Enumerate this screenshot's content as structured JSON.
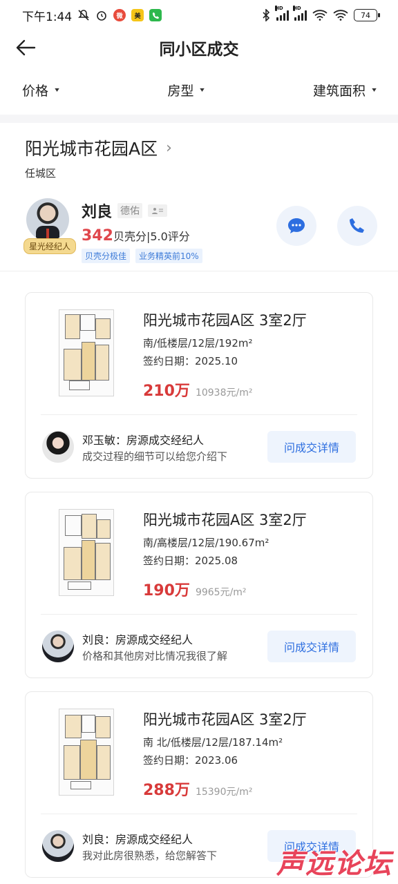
{
  "status_bar": {
    "time": "下午1:44",
    "battery": "74",
    "network_hd": "HD"
  },
  "header": {
    "title": "同小区成交"
  },
  "filters": [
    {
      "label": "价格"
    },
    {
      "label": "房型"
    },
    {
      "label": "建筑面积"
    }
  ],
  "community": {
    "name": "阳光城市花园A区",
    "district": "任城区"
  },
  "agent": {
    "name": "刘良",
    "brand": "德佑",
    "score_value": "342",
    "score_text": "贝壳分|5.0评分",
    "badge": "星光经纪人",
    "tags": [
      "贝壳分极佳",
      "业务精英前10%"
    ]
  },
  "deals": [
    {
      "title": "阳光城市花园A区 3室2厅",
      "meta": "南/低楼层/12层/192m²",
      "date": "签约日期：2025.10",
      "price": "210万",
      "unit_price": "10938元/m²",
      "agent_line": "邓玉敏：房源成交经纪人",
      "agent_note": "成交过程的细节可以给您介绍下",
      "button": "问成交详情"
    },
    {
      "title": "阳光城市花园A区 3室2厅",
      "meta": "南/高楼层/12层/190.67m²",
      "date": "签约日期：2025.08",
      "price": "190万",
      "unit_price": "9965元/m²",
      "agent_line": "刘良：房源成交经纪人",
      "agent_note": "价格和其他房对比情况我很了解",
      "button": "问成交详情"
    },
    {
      "title": "阳光城市花园A区 3室2厅",
      "meta": "南 北/低楼层/12层/187.14m²",
      "date": "签约日期：2023.06",
      "price": "288万",
      "unit_price": "15390元/m²",
      "agent_line": "刘良：房源成交经纪人",
      "agent_note": "我对此房很熟悉，给您解答下",
      "button": "问成交详情"
    }
  ],
  "watermark": "声远论坛",
  "colors": {
    "price_red": "#d83a3a",
    "accent_blue": "#2d6ee0",
    "score_red": "#e0474c"
  }
}
